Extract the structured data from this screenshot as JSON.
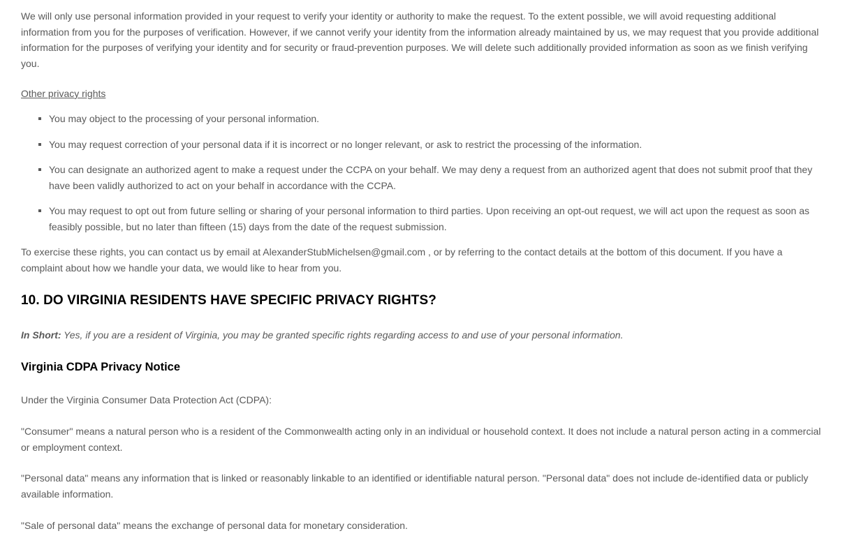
{
  "content": {
    "verification_paragraph": "We will only use personal information provided in your request to verify your identity or authority to make the request. To the extent possible, we will avoid requesting additional information from you for the purposes of verification. However, if we cannot verify your identity from the information already maintained by us, we may request that you provide additional information for the purposes of verifying your identity and for security or fraud-prevention purposes. We will delete such additionally provided information as soon as we finish verifying you.",
    "other_rights_heading": "Other privacy rights",
    "rights": [
      "You may object to the processing of your personal information.",
      "You may request correction of your personal data if it is incorrect or no longer relevant, or ask to restrict the processing of the information.",
      "You can designate an authorized agent to make a request under the CCPA on your behalf. We may deny a request from an authorized agent that does not submit proof that they have been validly authorized to act on your behalf in accordance with the CCPA.",
      "You may request to opt out from future selling or sharing of your personal information to third parties. Upon receiving an opt-out request, we will act upon the request as soon as feasibly possible, but no later than fifteen (15) days from the date of the request submission."
    ],
    "exercise_paragraph": "To exercise these rights, you can contact us by email at AlexanderStubMichelsen@gmail.com , or by referring to the contact details at the bottom of this document. If you have a complaint about how we handle your data, we would like to hear from you.",
    "section_heading": "10. DO VIRGINIA RESIDENTS HAVE SPECIFIC PRIVACY RIGHTS?",
    "in_short_label": "In Short:",
    "in_short_text": " Yes, if you are a resident of Virginia, you may be granted specific rights regarding access to and use of your personal information.",
    "subheading": "Virginia CDPA Privacy Notice",
    "cdpa_intro": "Under the Virginia Consumer Data Protection Act (CDPA):",
    "consumer_definition": "\"Consumer\" means a natural person who is a resident of the Commonwealth acting only in an individual or household context. It does not include a natural person acting in a commercial or employment context.",
    "personal_data_definition": "\"Personal data\" means any information that is linked or reasonably linkable to an identified or identifiable natural person. \"Personal data\" does not include de-identified data or publicly available information.",
    "sale_definition": "\"Sale of personal data\" means the exchange of personal data for monetary consideration."
  },
  "colors": {
    "body_text": "#595959",
    "heading_text": "#000000",
    "background": "#ffffff"
  }
}
